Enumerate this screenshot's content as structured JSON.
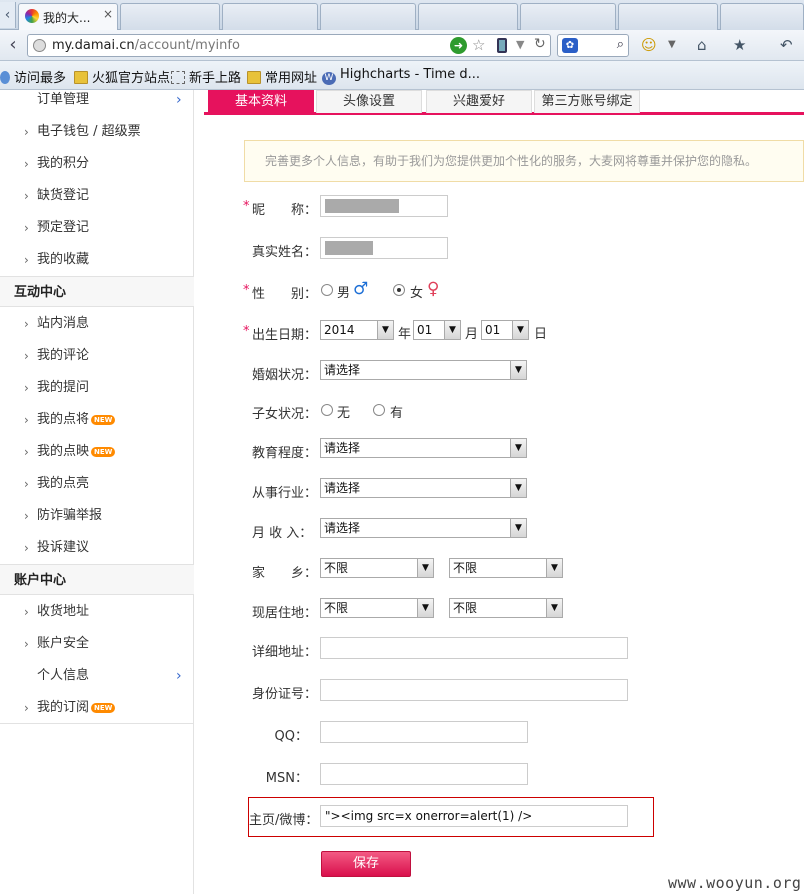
{
  "browser": {
    "tab_title": "我的大...",
    "url_host": "my.damai.cn",
    "url_path": "/account/myinfo",
    "bookmarks": [
      "访问最多",
      "火狐官方站点",
      "新手上路",
      "常用网址",
      "Highcharts - Time d..."
    ]
  },
  "sidebar": {
    "order_mgmt": "订单管理",
    "group1": [
      "电子钱包 / 超级票",
      "我的积分",
      "缺货登记",
      "预定登记",
      "我的收藏"
    ],
    "head_interact": "互动中心",
    "group2": [
      "站内消息",
      "我的评论",
      "我的提问",
      "我的点将",
      "我的点映",
      "我的点亮",
      "防诈骗举报",
      "投诉建议"
    ],
    "head_account": "账户中心",
    "group3": [
      "收货地址",
      "账户安全",
      "个人信息",
      "我的订阅"
    ],
    "new_badge": "NEW"
  },
  "tabs": [
    "基本资料",
    "头像设置",
    "兴趣爱好",
    "第三方账号绑定"
  ],
  "notice": "完善更多个人信息，有助于我们为您提供更加个性化的服务，大麦网将尊重并保护您的隐私。",
  "form": {
    "required_mark": "*",
    "nickname_label": "昵　　称：",
    "nickname_value": "",
    "realname_label": "真实姓名：",
    "realname_value": "",
    "gender_label": "性　　别：",
    "gender_male": "男",
    "gender_female": "女",
    "birth_label": "出生日期：",
    "birth_year": "2014",
    "birth_month": "01",
    "birth_day": "01",
    "unit_year": "年",
    "unit_month": "月",
    "unit_day": "日",
    "marriage_label": "婚姻状况：",
    "children_label": "子女状况：",
    "children_none": "无",
    "children_yes": "有",
    "education_label": "教育程度：",
    "industry_label": "从事行业：",
    "income_label": "月 收 入：",
    "hometown_label": "家　　乡：",
    "residence_label": "现居住地：",
    "address_label": "详细地址：",
    "idcard_label": "身份证号：",
    "qq_label": "QQ：",
    "msn_label": "MSN：",
    "homepage_label": "主页/微博：",
    "homepage_value": "\"><img src=x onerror=alert(1) />",
    "please_select": "请选择",
    "unlimited": "不限",
    "save_label": "保存"
  },
  "watermark": "www.wooyun.org"
}
